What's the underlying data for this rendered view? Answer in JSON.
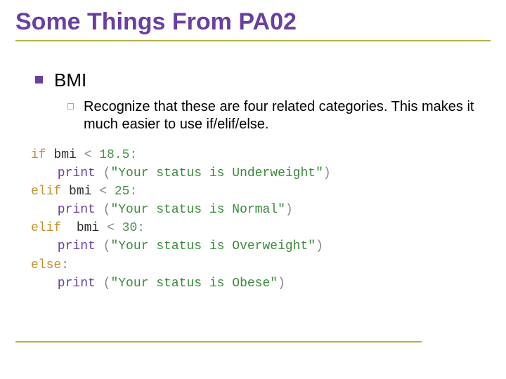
{
  "title": "Some Things From PA02",
  "bullet_main": "BMI",
  "bullet_sub": "Recognize that these are four related categories.  This makes it much easier to use if/elif/else.",
  "code": {
    "l1": {
      "kw": "if",
      "sp": " ",
      "id": "bmi",
      "op": " < ",
      "num": "18.5",
      "colon": ":"
    },
    "l2": {
      "fn": "print",
      "sp": " ",
      "lp": "(",
      "str": "\"Your status is Underweight\"",
      "rp": ")"
    },
    "l3": {
      "kw": "elif",
      "sp": " ",
      "id": "bmi",
      "op": " < ",
      "num": "25",
      "colon": ":"
    },
    "l4": {
      "fn": "print",
      "sp": " ",
      "lp": "(",
      "str": "\"Your status is Normal\"",
      "rp": ")"
    },
    "l5": {
      "kw": "elif",
      "sp": "  ",
      "id": "bmi",
      "op": " < ",
      "num": "30",
      "colon": ":"
    },
    "l6": {
      "fn": "print",
      "sp": " ",
      "lp": "(",
      "str": "\"Your status is Overweight\"",
      "rp": ")"
    },
    "l7": {
      "kw": "else",
      "colon": ":"
    },
    "l8": {
      "fn": "print",
      "sp": " ",
      "lp": "(",
      "str": "\"Your status is Obese\"",
      "rp": ")"
    }
  }
}
